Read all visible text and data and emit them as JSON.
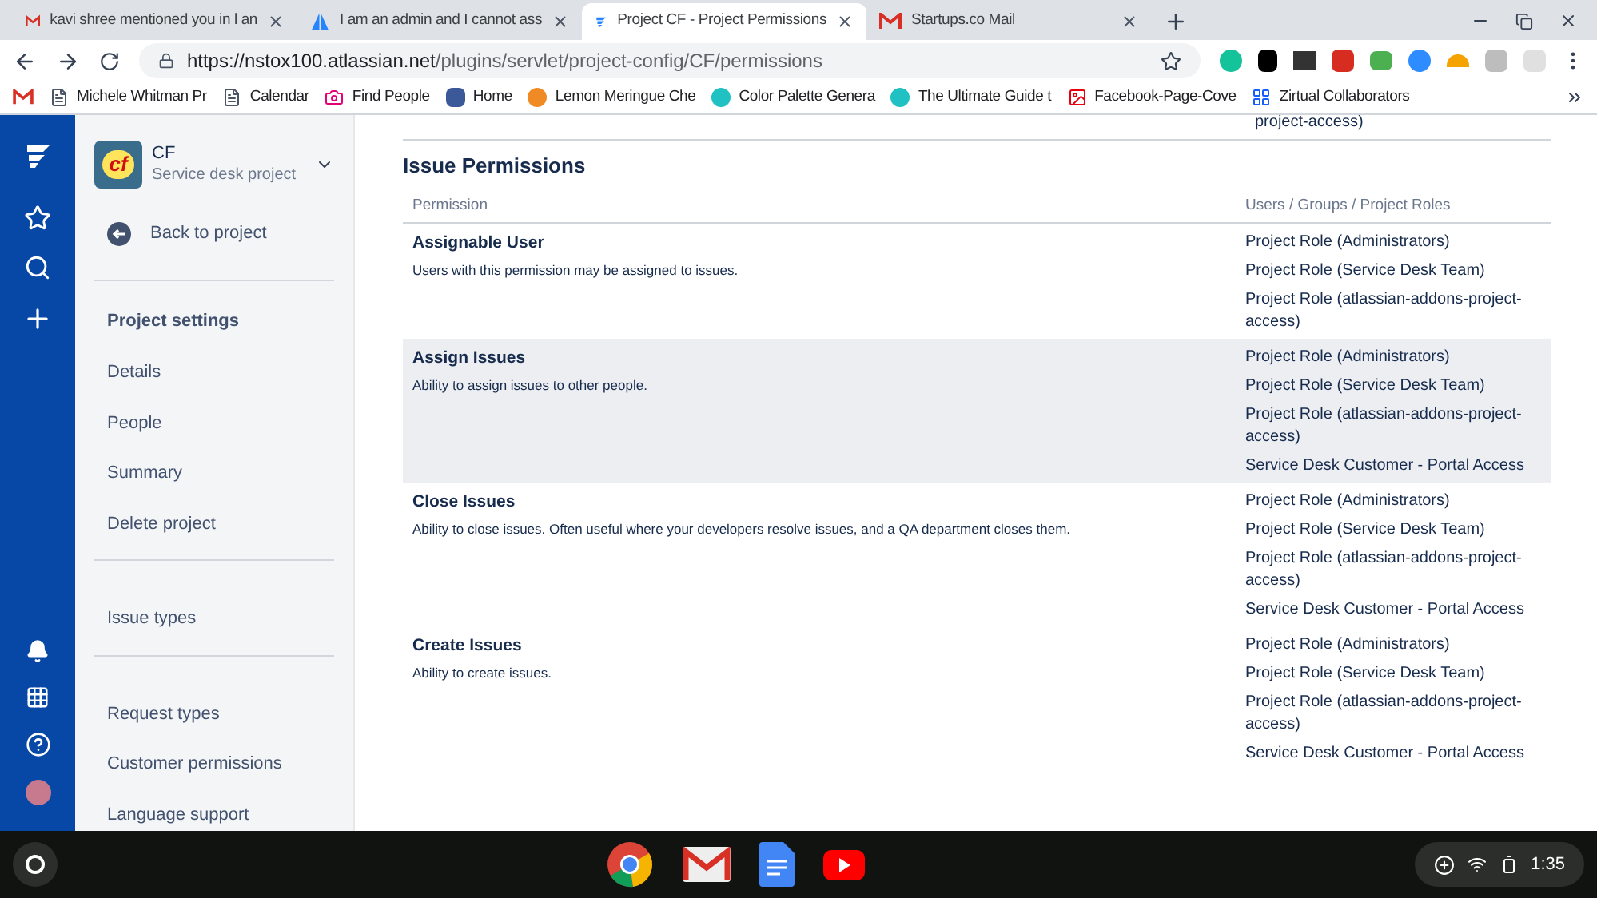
{
  "browser": {
    "tabs": [
      {
        "title": "kavi shree mentioned you in l an",
        "selected": false
      },
      {
        "title": "I am an admin and I cannot ass",
        "selected": false
      },
      {
        "title": "Project CF - Project Permissions",
        "selected": true
      },
      {
        "title": "Startups.co Mail",
        "selected": false
      }
    ],
    "address": {
      "origin": "https://nstox100.atlassian.net",
      "path": "/plugins/servlet/project-config/CF/permissions"
    },
    "bookmarks": [
      "Michele Whitman Pr",
      "Calendar",
      "Find People",
      "Home",
      "Lemon Meringue Che",
      "Color Palette Genera",
      "The Ultimate Guide t",
      "Facebook-Page-Cove",
      "Zirtual Collaborators"
    ]
  },
  "project": {
    "name": "CF",
    "type": "Service desk project",
    "logo_text": "cf"
  },
  "sidebar": {
    "back": "Back to project",
    "heading": "Project settings",
    "groups": [
      [
        "Details",
        "People",
        "Summary",
        "Delete project"
      ],
      [
        "Issue types"
      ],
      [
        "Request types",
        "Customer permissions",
        "Language support"
      ]
    ]
  },
  "section": {
    "previous_row_fragment": "project-access)",
    "title": "Issue Permissions",
    "columns": [
      "Permission",
      "Users / Groups / Project Roles"
    ],
    "rows": [
      {
        "name": "Assignable User",
        "description": "Users with this permission may be assigned to issues.",
        "highlighted": false,
        "roles": [
          "Project Role (Administrators)",
          "Project Role (Service Desk Team)",
          "Project Role (atlassian-addons-project-access)"
        ]
      },
      {
        "name": "Assign Issues",
        "description": "Ability to assign issues to other people.",
        "highlighted": true,
        "roles": [
          "Project Role (Administrators)",
          "Project Role (Service Desk Team)",
          "Project Role (atlassian-addons-project-access)",
          "Service Desk Customer - Portal Access"
        ]
      },
      {
        "name": "Close Issues",
        "description": "Ability to close issues. Often useful where your developers resolve issues, and a QA department closes them.",
        "highlighted": false,
        "roles": [
          "Project Role (Administrators)",
          "Project Role (Service Desk Team)",
          "Project Role (atlassian-addons-project-access)",
          "Service Desk Customer - Portal Access"
        ]
      },
      {
        "name": "Create Issues",
        "description": "Ability to create issues.",
        "highlighted": false,
        "roles": [
          "Project Role (Administrators)",
          "Project Role (Service Desk Team)",
          "Project Role (atlassian-addons-project-access)",
          "Service Desk Customer - Portal Access"
        ]
      }
    ]
  },
  "shelf": {
    "time": "1:35"
  }
}
